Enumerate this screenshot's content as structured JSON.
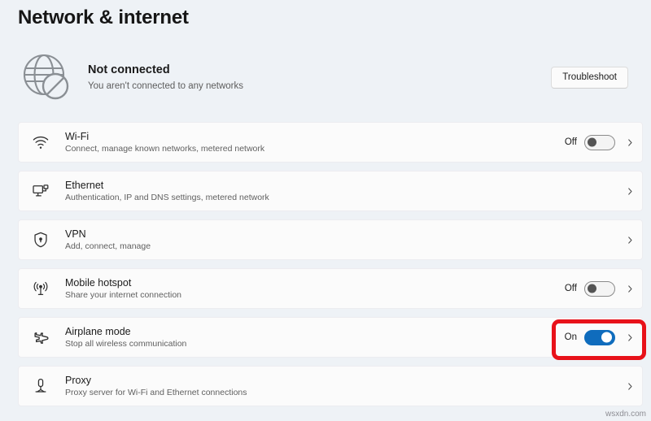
{
  "page": {
    "title": "Network & internet"
  },
  "status": {
    "icon": "globe-blocked-icon",
    "title": "Not connected",
    "subtitle": "You aren't connected to any networks",
    "troubleshoot_label": "Troubleshoot"
  },
  "settings": [
    {
      "id": "wifi",
      "icon": "wifi-icon",
      "title": "Wi-Fi",
      "subtitle": "Connect, manage known networks, metered network",
      "has_toggle": true,
      "toggle_state": "Off",
      "toggle_on": false,
      "has_chevron": true
    },
    {
      "id": "ethernet",
      "icon": "ethernet-icon",
      "title": "Ethernet",
      "subtitle": "Authentication, IP and DNS settings, metered network",
      "has_toggle": false,
      "toggle_state": "",
      "toggle_on": false,
      "has_chevron": true
    },
    {
      "id": "vpn",
      "icon": "shield-vpn-icon",
      "title": "VPN",
      "subtitle": "Add, connect, manage",
      "has_toggle": false,
      "toggle_state": "",
      "toggle_on": false,
      "has_chevron": true
    },
    {
      "id": "mobile-hotspot",
      "icon": "hotspot-broadcast-icon",
      "title": "Mobile hotspot",
      "subtitle": "Share your internet connection",
      "has_toggle": true,
      "toggle_state": "Off",
      "toggle_on": false,
      "has_chevron": true
    },
    {
      "id": "airplane-mode",
      "icon": "airplane-icon",
      "title": "Airplane mode",
      "subtitle": "Stop all wireless communication",
      "has_toggle": true,
      "toggle_state": "On",
      "toggle_on": true,
      "has_chevron": true
    },
    {
      "id": "proxy",
      "icon": "proxy-server-icon",
      "title": "Proxy",
      "subtitle": "Proxy server for Wi-Fi and Ethernet connections",
      "has_toggle": false,
      "toggle_state": "",
      "toggle_on": false,
      "has_chevron": true
    }
  ],
  "annotation": {
    "target": "airplane-mode-toggle",
    "color": "#e8121a"
  },
  "watermark": {
    "text": "wsxdn.com"
  },
  "colors": {
    "background": "#eef2f6",
    "card": "#fbfbfb",
    "toggle_on": "#0f6cbd",
    "highlight": "#e8121a"
  }
}
